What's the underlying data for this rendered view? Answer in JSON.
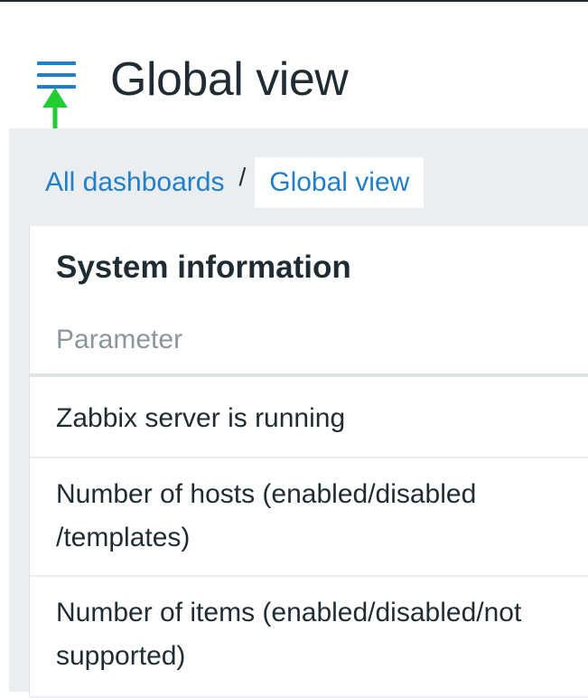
{
  "header": {
    "title": "Global view",
    "menu_icon": "hamburger-menu-icon",
    "annotation_arrow_color": "#22cc33"
  },
  "breadcrumb": {
    "parent_label": "All dashboards",
    "separator": "/",
    "current_label": "Global view"
  },
  "widget": {
    "title": "System information",
    "column_header": "Parameter",
    "rows": [
      {
        "label": "Zabbix server is running"
      },
      {
        "label_line1": "Number of hosts (enabled/disabled",
        "label_line2": "/templates)"
      },
      {
        "label_line1": "Number of items (enabled/disabled/not",
        "label_line2": "supported)"
      }
    ]
  },
  "colors": {
    "accent": "#1f7fc8",
    "text": "#1f2c33",
    "muted": "#8a969c",
    "background": "#ebeef0"
  }
}
